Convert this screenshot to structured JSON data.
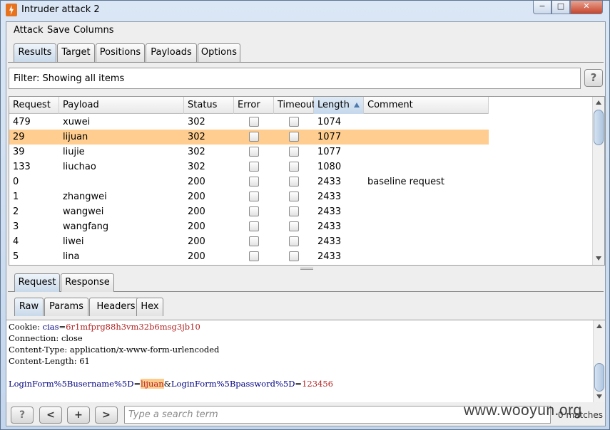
{
  "window": {
    "title": "Intruder attack 2",
    "minimize": "−",
    "maximize": "□",
    "close": "✕"
  },
  "menu": {
    "attack": "Attack",
    "save": "Save",
    "columns": "Columns"
  },
  "top_tabs": [
    "Results",
    "Target",
    "Positions",
    "Payloads",
    "Options"
  ],
  "filter": {
    "text": "Filter: Showing all items",
    "help": "?"
  },
  "table": {
    "headers": [
      "Request",
      "Payload",
      "Status",
      "Error",
      "Timeout",
      "Length",
      "Comment"
    ],
    "sorted_column": "Length",
    "rows": [
      {
        "request": "479",
        "payload": "xuwei",
        "status": "302",
        "length": "1074",
        "comment": ""
      },
      {
        "request": "29",
        "payload": "lijuan",
        "status": "302",
        "length": "1077",
        "comment": ""
      },
      {
        "request": "39",
        "payload": "liujie",
        "status": "302",
        "length": "1077",
        "comment": ""
      },
      {
        "request": "133",
        "payload": "liuchao",
        "status": "302",
        "length": "1080",
        "comment": ""
      },
      {
        "request": "0",
        "payload": "",
        "status": "200",
        "length": "2433",
        "comment": "baseline request"
      },
      {
        "request": "1",
        "payload": "zhangwei",
        "status": "200",
        "length": "2433",
        "comment": ""
      },
      {
        "request": "2",
        "payload": "wangwei",
        "status": "200",
        "length": "2433",
        "comment": ""
      },
      {
        "request": "3",
        "payload": "wangfang",
        "status": "200",
        "length": "2433",
        "comment": ""
      },
      {
        "request": "4",
        "payload": "liwei",
        "status": "200",
        "length": "2433",
        "comment": ""
      },
      {
        "request": "5",
        "payload": "lina",
        "status": "200",
        "length": "2433",
        "comment": ""
      }
    ],
    "selected_row_color": "#fecd8f"
  },
  "detail_tabs": [
    "Request",
    "Response"
  ],
  "view_tabs": [
    "Raw",
    "Params",
    "Headers",
    "Hex"
  ],
  "raw": {
    "cookie_key": "Cookie: ",
    "cookie_name": "cias",
    "cookie_eq": "=",
    "cookie_value": "6r1mfprg88h3vm32b6msg3jb10",
    "connection": "Connection: close",
    "content_type": "Content-Type: application/x-www-form-urlencoded",
    "content_length": "Content-Length: 61",
    "body_user_key": "LoginForm%5Busername%5D",
    "body_eq1": "=",
    "body_user_val": "lijuan",
    "body_amp": "&",
    "body_pass_key": "LoginForm%5Bpassword%5D",
    "body_eq2": "=",
    "body_pass_val": "123456"
  },
  "search": {
    "help": "?",
    "prev": "<",
    "add": "+",
    "next": ">",
    "placeholder": "Type a search term",
    "matches": "0 matches"
  },
  "watermark": "www.wooyun.org"
}
